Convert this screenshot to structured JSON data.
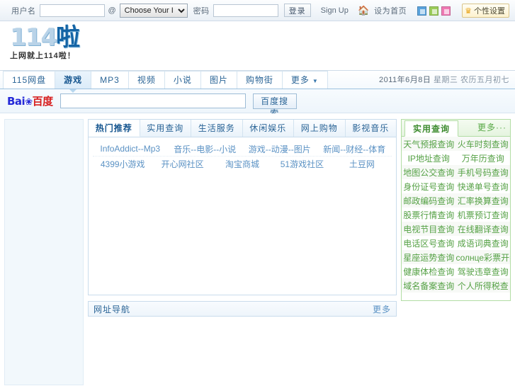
{
  "topbar": {
    "user_label": "用户名",
    "username_value": "",
    "at_symbol": "@",
    "domain_select_value": "Choose Your I",
    "domain_options": [
      "Choose Your I"
    ],
    "password_label": "密码",
    "password_value": "",
    "login_button": "登录",
    "signup_link": "Sign Up",
    "home_icon": "home-icon",
    "home_label": "设为首页",
    "swatches": [
      {
        "name": "theme-blue",
        "color": "#5aa3dd"
      },
      {
        "name": "theme-green",
        "color": "#9bcc5a"
      },
      {
        "name": "theme-pink",
        "color": "#f07ab4"
      }
    ],
    "skin_icon": "crown-icon",
    "skin_label": "个性设置"
  },
  "logo": {
    "number": "114",
    "suffix": "啦",
    "tagline": "上网就上114啦！"
  },
  "nav": {
    "tabs": [
      {
        "label": "115网盘",
        "active": false,
        "caret": false
      },
      {
        "label": "游戏",
        "active": true,
        "caret": false
      },
      {
        "label": "MP3",
        "active": false,
        "caret": false
      },
      {
        "label": "视频",
        "active": false,
        "caret": false
      },
      {
        "label": "小说",
        "active": false,
        "caret": false
      },
      {
        "label": "图片",
        "active": false,
        "caret": false
      },
      {
        "label": "购物街",
        "active": false,
        "caret": false
      },
      {
        "label": "更多",
        "active": false,
        "caret": true
      }
    ],
    "caret_glyph": "▼",
    "date": "2011年6月8日",
    "weekday": "星期三",
    "lunar": "农历五月初七"
  },
  "search": {
    "engine_blue": "Bai",
    "engine_paw": "❀",
    "engine_red": "百度",
    "value": "",
    "button": "百度搜索"
  },
  "center_card": {
    "tabs": [
      {
        "label": "热门推荐",
        "active": true
      },
      {
        "label": "实用查询",
        "active": false
      },
      {
        "label": "生活服务",
        "active": false
      },
      {
        "label": "休闲娱乐",
        "active": false
      },
      {
        "label": "网上购物",
        "active": false
      },
      {
        "label": "影视音乐",
        "active": false
      }
    ],
    "rows": [
      [
        "InfoAddict--Mp3",
        "音乐--电影--小说",
        "游戏--动漫--图片",
        "新闻--财经--体育"
      ],
      [
        "4399小游戏",
        "开心网社区",
        "淘宝商城",
        "51游戏社区",
        "土豆网"
      ]
    ]
  },
  "green_panel": {
    "tab_label": "实用查询",
    "more_label": "更多···",
    "rows": [
      [
        "天气预报查询",
        "火车时刻查询"
      ],
      [
        "IP地址查询",
        "万年历查询"
      ],
      [
        "地图公交查询",
        "手机号码查询"
      ],
      [
        "身份证号查询",
        "快递单号查询"
      ],
      [
        "邮政编码查询",
        "汇率换算查询"
      ],
      [
        "股票行情查询",
        "机票预订查询"
      ],
      [
        "电视节目查询",
        "在线翻译查询"
      ],
      [
        "电话区号查询",
        "成语词典查询"
      ],
      [
        "星座运势查询",
        "солнце彩票开奖"
      ],
      [
        "健康体检查询",
        "驾驶违章查询"
      ],
      [
        "域名备案查询",
        "个人所得税查"
      ]
    ]
  },
  "bottom_bar": {
    "title": "网址导航",
    "more": "更多"
  }
}
